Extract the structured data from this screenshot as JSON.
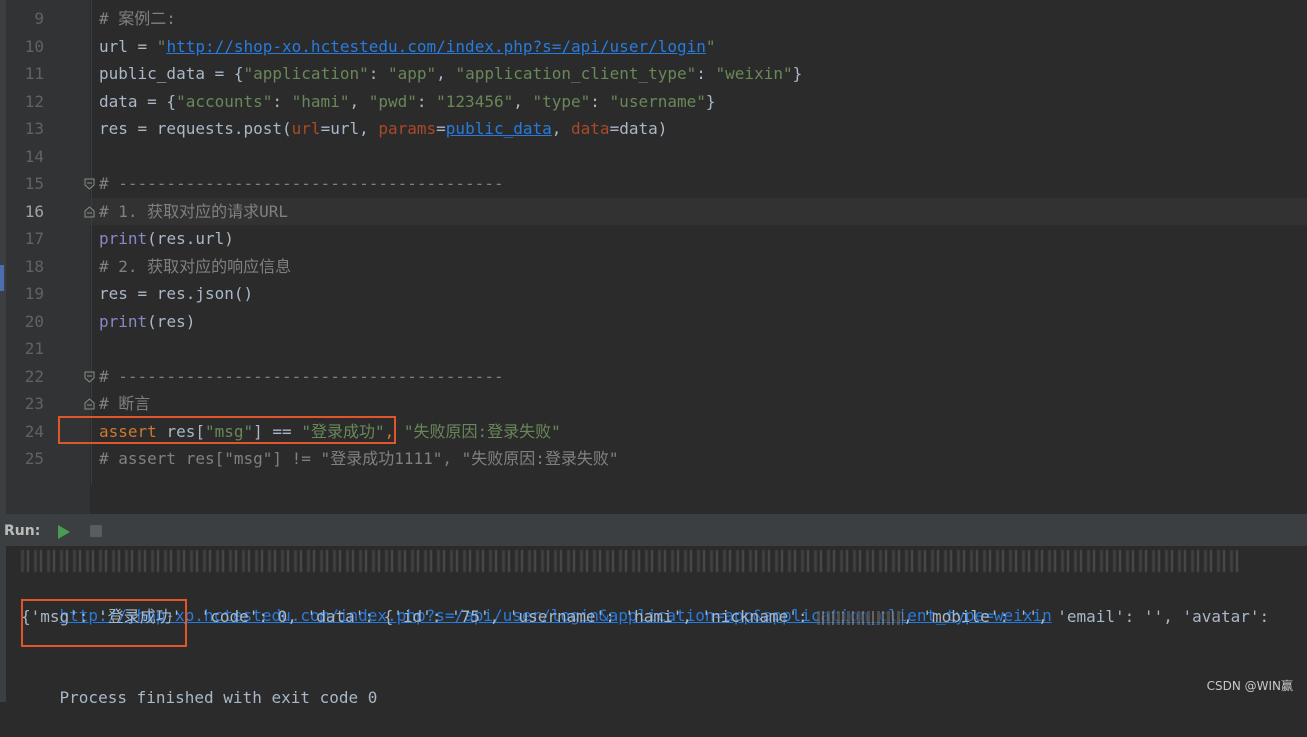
{
  "editor": {
    "lines": [
      {
        "n": "9",
        "tokens": [
          {
            "c": "cm",
            "t": "# 案例二:"
          }
        ]
      },
      {
        "n": "10",
        "tokens": [
          {
            "c": "",
            "t": "url = "
          },
          {
            "c": "str",
            "t": "\""
          },
          {
            "c": "url",
            "t": "http://shop-xo.hctestedu.com/index.php?s=/api/user/login"
          },
          {
            "c": "str",
            "t": "\""
          }
        ]
      },
      {
        "n": "11",
        "tokens": [
          {
            "c": "",
            "t": "public_data = {"
          },
          {
            "c": "str",
            "t": "\"application\""
          },
          {
            "c": "",
            "t": ": "
          },
          {
            "c": "str",
            "t": "\"app\""
          },
          {
            "c": "",
            "t": ", "
          },
          {
            "c": "str",
            "t": "\"application_client_type\""
          },
          {
            "c": "",
            "t": ": "
          },
          {
            "c": "str",
            "t": "\"weixin\""
          },
          {
            "c": "",
            "t": "}"
          }
        ]
      },
      {
        "n": "12",
        "tokens": [
          {
            "c": "",
            "t": "data = {"
          },
          {
            "c": "str",
            "t": "\"accounts\""
          },
          {
            "c": "",
            "t": ": "
          },
          {
            "c": "str",
            "t": "\"hami\""
          },
          {
            "c": "",
            "t": ", "
          },
          {
            "c": "str",
            "t": "\"pwd\""
          },
          {
            "c": "",
            "t": ": "
          },
          {
            "c": "str",
            "t": "\"123456\""
          },
          {
            "c": "",
            "t": ", "
          },
          {
            "c": "str",
            "t": "\"type\""
          },
          {
            "c": "",
            "t": ": "
          },
          {
            "c": "str",
            "t": "\"username\""
          },
          {
            "c": "",
            "t": "}"
          }
        ]
      },
      {
        "n": "13",
        "tokens": [
          {
            "c": "",
            "t": "res = requests.post("
          },
          {
            "c": "param",
            "t": "url"
          },
          {
            "c": "",
            "t": "=url, "
          },
          {
            "c": "param",
            "t": "params"
          },
          {
            "c": "",
            "t": "="
          },
          {
            "c": "hl",
            "t": "public_data"
          },
          {
            "c": "",
            "t": ", "
          },
          {
            "c": "param",
            "t": "data"
          },
          {
            "c": "",
            "t": "=data)"
          }
        ]
      },
      {
        "n": "14",
        "tokens": []
      },
      {
        "n": "15",
        "fold": "open",
        "tokens": [
          {
            "c": "cm",
            "t": "# ----------------------------------------"
          }
        ]
      },
      {
        "n": "16",
        "fold": "close",
        "current": true,
        "tokens": [
          {
            "c": "cm",
            "t": "# 1. 获取对应的请求URL"
          }
        ]
      },
      {
        "n": "17",
        "tokens": [
          {
            "c": "bi",
            "t": "print"
          },
          {
            "c": "",
            "t": "(res.url)"
          }
        ]
      },
      {
        "n": "18",
        "tokens": [
          {
            "c": "cm",
            "t": "# 2. 获取对应的响应信息"
          }
        ]
      },
      {
        "n": "19",
        "tokens": [
          {
            "c": "",
            "t": "res = res.json()"
          }
        ]
      },
      {
        "n": "20",
        "tokens": [
          {
            "c": "bi",
            "t": "print"
          },
          {
            "c": "",
            "t": "(res)"
          }
        ]
      },
      {
        "n": "21",
        "tokens": []
      },
      {
        "n": "22",
        "fold": "open",
        "tokens": [
          {
            "c": "cm",
            "t": "# ----------------------------------------"
          }
        ]
      },
      {
        "n": "23",
        "fold": "close",
        "tokens": [
          {
            "c": "cm",
            "t": "# 断言"
          }
        ]
      },
      {
        "n": "24",
        "tokens": [
          {
            "c": "kw",
            "t": "assert "
          },
          {
            "c": "",
            "t": "res["
          },
          {
            "c": "str",
            "t": "\"msg\""
          },
          {
            "c": "",
            "t": "] == "
          },
          {
            "c": "str",
            "t": "\"登录成功\""
          },
          {
            "c": "kw",
            "t": ", "
          },
          {
            "c": "str",
            "t": "\"失败原因:登录失败\""
          }
        ]
      },
      {
        "n": "25",
        "tokens": [
          {
            "c": "cm",
            "t": "# assert res[\"msg\"] != \"登录成功1111\", \"失败原因:登录失败\""
          }
        ]
      }
    ]
  },
  "run_panel": {
    "label": "Run:",
    "run_icon": "play-icon",
    "stop_icon": "stop-icon"
  },
  "console": {
    "url_line": "http://shop-xo.hctestedu.com/index.php?s=/api/user/login&application=app&application_client_type=weixin",
    "json_line_a": "{'msg': '登录成功'",
    "json_line_b": ", 'code': 0, 'data': {'id': '75', 'username': 'hami', 'nickname': ",
    "json_line_c": ", 'mobile': '', 'email': '', 'avatar':",
    "exit_line": "Process finished with exit code 0"
  },
  "watermark": "CSDN @WIN赢"
}
